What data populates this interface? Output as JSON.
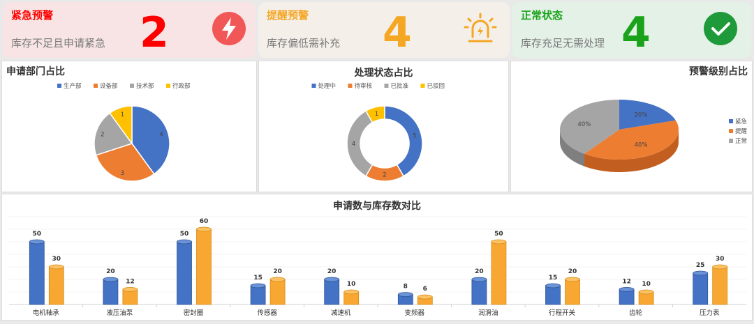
{
  "alerts": [
    {
      "title": "紧急预警",
      "desc": "库存不足且申请紧急",
      "count": "2",
      "color": "#ff0000",
      "bg": "#f8e4e4",
      "icon": "lightning-bolt-icon"
    },
    {
      "title": "提醒预警",
      "desc": "库存偏低需补充",
      "count": "4",
      "color": "#f5a623",
      "bg": "#f5efe9",
      "icon": "alarm-light-icon"
    },
    {
      "title": "正常状态",
      "desc": "库存充足无需处理",
      "count": "4",
      "color": "#1aa31a",
      "bg": "#e3f1e7",
      "icon": "check-circle-icon"
    }
  ],
  "colors": {
    "blue": "#4472c4",
    "orange": "#ed7d31",
    "gray": "#a5a5a5",
    "yellow": "#ffc000",
    "bar_orange": "#f8a832"
  },
  "chart_data": [
    {
      "type": "pie",
      "title": "申请部门占比",
      "labels": [
        "生产部",
        "设备部",
        "技术部",
        "行政部"
      ],
      "values": [
        4,
        3,
        2,
        1
      ],
      "legend": "top"
    },
    {
      "type": "pie",
      "subtype": "donut",
      "title": "处理状态占比",
      "labels": [
        "处理中",
        "待审核",
        "已批准",
        "已驳回"
      ],
      "values": [
        5,
        2,
        4,
        1
      ],
      "legend": "top"
    },
    {
      "type": "pie",
      "subtype": "3d",
      "title": "预警级别占比",
      "labels": [
        "紧急",
        "提醒",
        "正常"
      ],
      "values": [
        20,
        40,
        40
      ],
      "value_labels": [
        "20%",
        "40%",
        "40%"
      ],
      "legend": "right"
    },
    {
      "type": "bar",
      "title": "申请数与库存数对比",
      "categories": [
        "电机轴承",
        "液压油泵",
        "密封圈",
        "传感器",
        "减速机",
        "变频器",
        "润滑油",
        "行程开关",
        "齿轮",
        "压力表"
      ],
      "series": [
        {
          "values": [
            50,
            20,
            50,
            15,
            20,
            8,
            20,
            15,
            12,
            25
          ]
        },
        {
          "values": [
            30,
            12,
            60,
            20,
            10,
            6,
            50,
            20,
            10,
            30
          ]
        }
      ],
      "ylim": [
        0,
        70
      ],
      "grid": true
    }
  ]
}
